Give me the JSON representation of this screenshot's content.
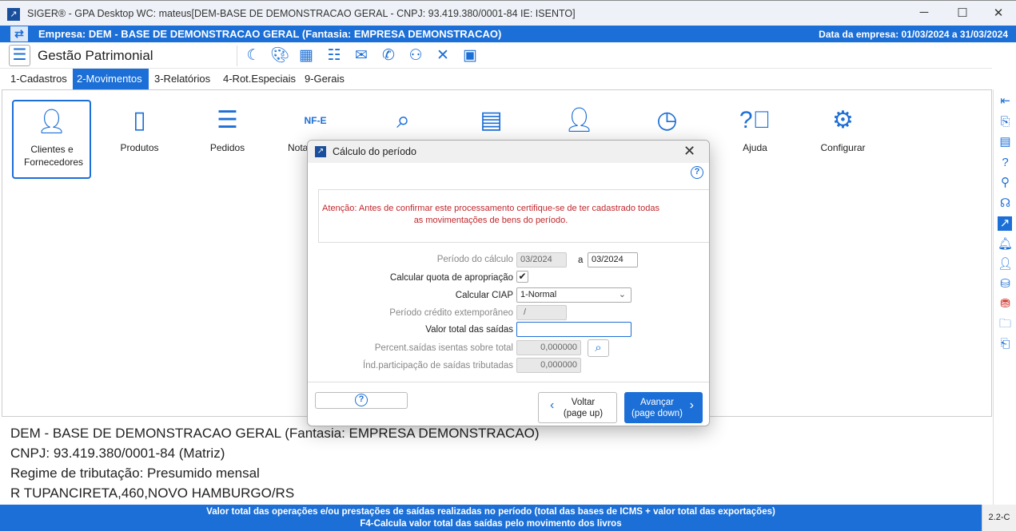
{
  "window": {
    "title": "SIGER® - GPA Desktop WC: mateus[DEM-BASE DE DEMONSTRACAO GERAL - CNPJ: 93.419.380/0001-84 IE: ISENTO]",
    "minimize": "─",
    "maximize": "☐",
    "close": "✕"
  },
  "company_bar": {
    "company": "Empresa: DEM - BASE DE DEMONSTRACAO GERAL (Fantasia: EMPRESA DEMONSTRACAO)",
    "date": "Data da empresa: 01/03/2024 a 31/03/2024"
  },
  "toolbar": {
    "module": "Gestão Patrimonial",
    "icons": [
      "moon-icon",
      "palette-icon",
      "calculator-icon",
      "calendar-icon",
      "mail-icon",
      "phone-icon",
      "users-icon",
      "tools-icon",
      "briefcase-icon"
    ]
  },
  "menu": [
    {
      "label": "1-Cadastros"
    },
    {
      "label": "2-Movimentos",
      "active": true
    },
    {
      "label": "3-Relatórios"
    },
    {
      "label": "4-Rot.Especiais"
    },
    {
      "label": "9-Gerais"
    }
  ],
  "tiles": [
    {
      "label": "Clientes e Fornecedores"
    },
    {
      "label": "Produtos"
    },
    {
      "label": "Pedidos"
    },
    {
      "label": "Nota"
    },
    {
      "label": ""
    },
    {
      "label": ""
    },
    {
      "label": ""
    },
    {
      "label": ""
    },
    {
      "label": "Ajuda"
    },
    {
      "label": "Configurar"
    }
  ],
  "company_info": {
    "line1": "DEM - BASE DE DEMONSTRACAO GERAL (Fantasia: EMPRESA DEMONSTRACAO)",
    "line2": "CNPJ: 93.419.380/0001-84 (Matriz)",
    "line3": "Regime de tributação: Presumido mensal",
    "line4": "R TUPANCIRETA,460,NOVO HAMBURGO/RS"
  },
  "status": {
    "line1": "Valor total das operações e/ou prestações de saídas realizadas no período (total das bases de ICMS + valor total das exportações)",
    "line2": "F4-Calcula valor total das saídas pelo movimento dos livros",
    "version": "2.2-C"
  },
  "dialog": {
    "title": "Cálculo do período",
    "warning_line1": "Atenção: Antes de confirmar este processamento certifique-se de ter cadastrado todas",
    "warning_line2": "as movimentações de bens do período.",
    "periodo_label": "Período do cálculo",
    "periodo_from": "03/2024",
    "periodo_sep": "a",
    "periodo_to": "03/2024",
    "quota_label": "Calcular quota de apropriação",
    "quota_checked": true,
    "check_mark": "✔",
    "ciap_label": "Calcular CIAP",
    "ciap_value": "1-Normal",
    "extemp_label": "Período crédito extemporâneo",
    "extemp_value": "/",
    "valor_label": "Valor total das saídas",
    "valor_value": "",
    "percent_label": "Percent.saídas isentas sobre total",
    "percent_value": "0,000000",
    "ind_label": "Índ.participação de saídas tributadas",
    "ind_value": "0,000000",
    "back_l1": "Voltar",
    "back_l2": "(page up)",
    "next_l1": "Avançar",
    "next_l2": "(page down)"
  },
  "colors": {
    "accent": "#1c6fd6",
    "warning": "#c0272d"
  }
}
